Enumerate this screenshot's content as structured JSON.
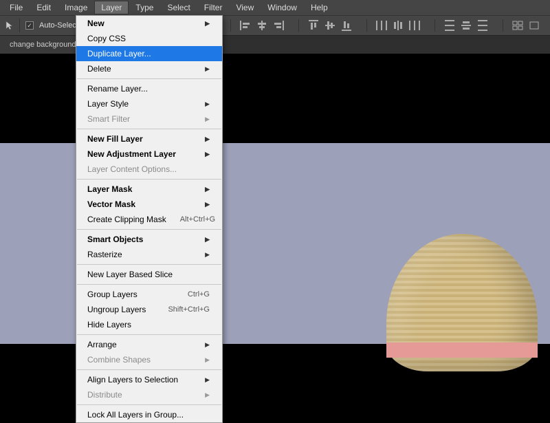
{
  "menubar": {
    "items": [
      "File",
      "Edit",
      "Image",
      "Layer",
      "Type",
      "Select",
      "Filter",
      "View",
      "Window",
      "Help"
    ],
    "open_index": 3
  },
  "toolbar": {
    "auto_select_label": "Auto-Select:"
  },
  "tab": {
    "label": "change background c"
  },
  "dropdown": {
    "items": [
      {
        "label": "New",
        "bold": true,
        "sub": true
      },
      {
        "label": "Copy CSS"
      },
      {
        "label": "Duplicate Layer...",
        "hl": true
      },
      {
        "label": "Delete",
        "sub": true
      },
      {
        "sep": true
      },
      {
        "label": "Rename Layer..."
      },
      {
        "label": "Layer Style",
        "sub": true
      },
      {
        "label": "Smart Filter",
        "dis": true,
        "sub": true
      },
      {
        "sep": true
      },
      {
        "label": "New Fill Layer",
        "bold": true,
        "sub": true
      },
      {
        "label": "New Adjustment Layer",
        "bold": true,
        "sub": true
      },
      {
        "label": "Layer Content Options...",
        "dis": true
      },
      {
        "sep": true
      },
      {
        "label": "Layer Mask",
        "bold": true,
        "sub": true
      },
      {
        "label": "Vector Mask",
        "bold": true,
        "sub": true
      },
      {
        "label": "Create Clipping Mask",
        "sc": "Alt+Ctrl+G"
      },
      {
        "sep": true
      },
      {
        "label": "Smart Objects",
        "bold": true,
        "sub": true
      },
      {
        "label": "Rasterize",
        "sub": true
      },
      {
        "sep": true
      },
      {
        "label": "New Layer Based Slice"
      },
      {
        "sep": true
      },
      {
        "label": "Group Layers",
        "sc": "Ctrl+G"
      },
      {
        "label": "Ungroup Layers",
        "sc": "Shift+Ctrl+G"
      },
      {
        "label": "Hide Layers"
      },
      {
        "sep": true
      },
      {
        "label": "Arrange",
        "sub": true
      },
      {
        "label": "Combine Shapes",
        "dis": true,
        "sub": true
      },
      {
        "sep": true
      },
      {
        "label": "Align Layers to Selection",
        "sub": true
      },
      {
        "label": "Distribute",
        "dis": true,
        "sub": true
      },
      {
        "sep": true
      },
      {
        "label": "Lock All Layers in Group..."
      }
    ]
  }
}
